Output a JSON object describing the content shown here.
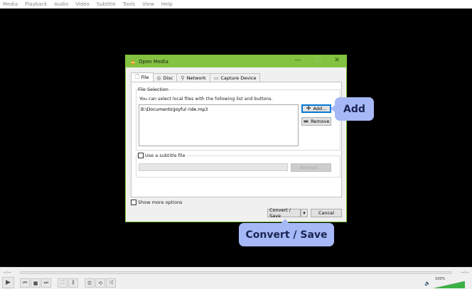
{
  "menubar": {
    "items": [
      "Media",
      "Playback",
      "Audio",
      "Video",
      "Subtitle",
      "Tools",
      "View",
      "Help"
    ]
  },
  "dialog": {
    "title": "Open Media",
    "window_buttons": {
      "minimize": "—",
      "maximize": "☐",
      "close": "✕"
    },
    "tabs": [
      {
        "label": "File",
        "icon": "file-icon",
        "glyph": "🗋"
      },
      {
        "label": "Disc",
        "icon": "disc-icon",
        "glyph": "◎"
      },
      {
        "label": "Network",
        "icon": "network-icon",
        "glyph": "⚲"
      },
      {
        "label": "Capture Device",
        "icon": "capture-device-icon",
        "glyph": "▭"
      }
    ],
    "file_selection": {
      "group_label": "File Selection",
      "hint": "You can select local files with the following list and buttons.",
      "files": [
        "B:\\Documents\\Joyful ride.mp3"
      ],
      "add_label": "Add...",
      "remove_label": "Remove"
    },
    "subtitle": {
      "checkbox_label": "Use a subtitle file",
      "browse_label": "Browse..."
    },
    "show_more_label": "Show more options",
    "convert_label": "Convert / Save",
    "dropdown_glyph": "▾",
    "cancel_label": "Cancel"
  },
  "controls": {
    "time_elapsed": "--:--",
    "time_total": "--:--",
    "volume_percent": "100%"
  },
  "callouts": {
    "add": "Add",
    "convert": "Convert / Save"
  },
  "colors": {
    "title_bar": "#84c341",
    "callout": "#a6b8f5",
    "volume": "#3cb043"
  }
}
